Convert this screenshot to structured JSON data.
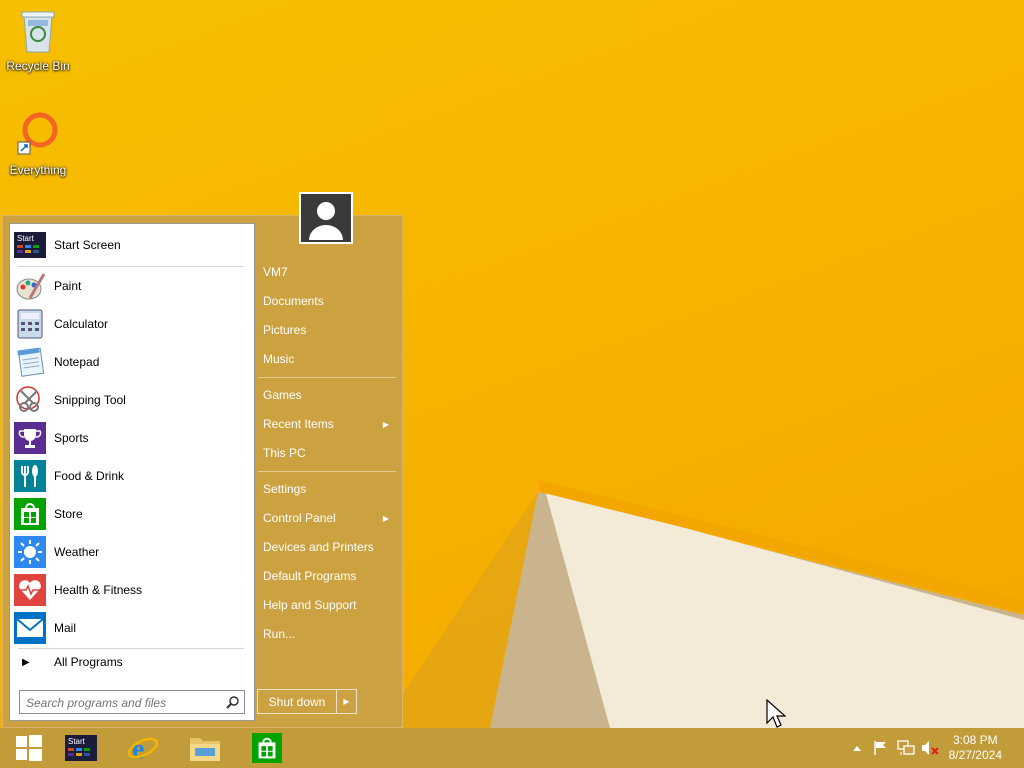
{
  "desktop": {
    "icons": [
      {
        "label": "Recycle Bin",
        "icon": "recycle-bin-icon"
      },
      {
        "label": "Everything",
        "icon": "everything-icon"
      }
    ]
  },
  "start_menu": {
    "pinned": {
      "label": "Start Screen",
      "icon": "start-screen-icon",
      "icon_text": "Start"
    },
    "programs": [
      {
        "label": "Paint",
        "icon": "paint-icon"
      },
      {
        "label": "Calculator",
        "icon": "calculator-icon"
      },
      {
        "label": "Notepad",
        "icon": "notepad-icon"
      },
      {
        "label": "Snipping Tool",
        "icon": "snipping-tool-icon"
      },
      {
        "label": "Sports",
        "icon": "sports-icon",
        "color": "#5c2d91"
      },
      {
        "label": "Food & Drink",
        "icon": "food-drink-icon",
        "color": "#008299"
      },
      {
        "label": "Store",
        "icon": "store-icon",
        "color": "#00a300"
      },
      {
        "label": "Weather",
        "icon": "weather-icon",
        "color": "#2d89ef"
      },
      {
        "label": "Health & Fitness",
        "icon": "health-fitness-icon",
        "color": "#e0443e"
      },
      {
        "label": "Mail",
        "icon": "mail-icon",
        "color": "#0072c6"
      }
    ],
    "all_programs": "All Programs",
    "search_placeholder": "Search programs and files",
    "right": {
      "user": "VM7",
      "group1": [
        "Documents",
        "Pictures",
        "Music"
      ],
      "group2": [
        {
          "label": "Games",
          "submenu": false
        },
        {
          "label": "Recent Items",
          "submenu": true
        },
        {
          "label": "This PC",
          "submenu": false
        }
      ],
      "group3": [
        {
          "label": "Settings",
          "submenu": false
        },
        {
          "label": "Control Panel",
          "submenu": true
        },
        {
          "label": "Devices and Printers",
          "submenu": false
        },
        {
          "label": "Default Programs",
          "submenu": false
        },
        {
          "label": "Help and Support",
          "submenu": false
        },
        {
          "label": "Run...",
          "submenu": false
        }
      ]
    },
    "shutdown": "Shut down"
  },
  "taskbar": {
    "buttons": [
      "start-button",
      "start-screen",
      "internet-explorer",
      "file-explorer",
      "store"
    ],
    "start_icon_text": "Start",
    "clock": {
      "time": "3:08 PM",
      "date": "8/27/2024"
    }
  },
  "colors": {
    "accent": "#f4b400",
    "menu_bg": "#c9a048"
  }
}
